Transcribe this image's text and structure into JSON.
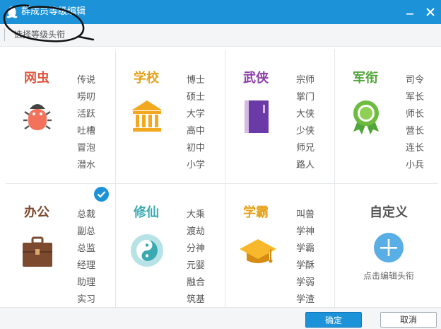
{
  "window": {
    "title": "群成员等级编辑"
  },
  "subheader": {
    "title": "选择等级头衔"
  },
  "categories": [
    {
      "name": "网虫",
      "color": "#e0553e",
      "items": [
        "传说",
        "唠叨",
        "活跃",
        "吐槽",
        "冒泡",
        "潜水"
      ]
    },
    {
      "name": "学校",
      "color": "#e5a21c",
      "items": [
        "博士",
        "硕士",
        "大学",
        "高中",
        "初中",
        "小学"
      ]
    },
    {
      "name": "武侠",
      "color": "#8c3fa8",
      "items": [
        "宗师",
        "掌门",
        "大侠",
        "少侠",
        "师兄",
        "路人"
      ]
    },
    {
      "name": "军衔",
      "color": "#52a53b",
      "items": [
        "司令",
        "军长",
        "师长",
        "营长",
        "连长",
        "小兵"
      ]
    },
    {
      "name": "办公",
      "color": "#7b4a2f",
      "items": [
        "总裁",
        "副总",
        "总监",
        "经理",
        "助理",
        "实习"
      ]
    },
    {
      "name": "修仙",
      "color": "#3aa9b1",
      "items": [
        "大乘",
        "渡劫",
        "分神",
        "元婴",
        "融合",
        "筑基"
      ]
    },
    {
      "name": "学霸",
      "color": "#e5a21c",
      "items": [
        "叫兽",
        "学神",
        "学霸",
        "学酥",
        "学弱",
        "学渣"
      ]
    }
  ],
  "custom": {
    "title": "自定义",
    "subtitle": "点击编辑头衔"
  },
  "selected_category": "办公",
  "buttons": {
    "ok": "确定",
    "cancel": "取消"
  },
  "colors": {
    "titlebar": "#1c93d8",
    "accent": "#1c93d8"
  }
}
